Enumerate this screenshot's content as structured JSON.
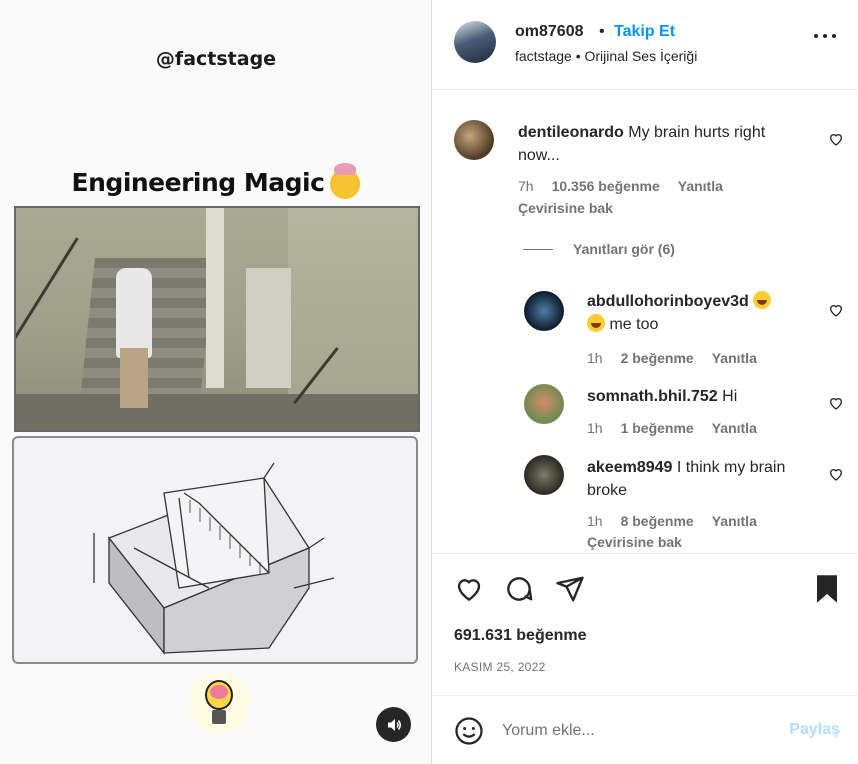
{
  "media": {
    "handle": "@factstage",
    "title": "Engineering Magic"
  },
  "header": {
    "username": "om87608",
    "separator": "•",
    "follow_label": "Takip Et",
    "subtitle": "factstage • Orijinal Ses İçeriği"
  },
  "comments": [
    {
      "username": "dentileonardo",
      "text": "My brain hurts right now...",
      "time": "7h",
      "likes": "10.356 beğenme",
      "reply": "Yanıtla",
      "translate": "Çevirisine bak",
      "view_replies": "Yanıtları gör (6)"
    },
    {
      "username": "abdullohorinboyev3d",
      "text": "me too",
      "time": "1h",
      "likes": "2 beğenme",
      "reply": "Yanıtla"
    },
    {
      "username": "somnath.bhil.752",
      "text": "Hi",
      "time": "1h",
      "likes": "1 beğenme",
      "reply": "Yanıtla"
    },
    {
      "username": "akeem8949",
      "text": "I think my brain broke",
      "time": "1h",
      "likes": "8 beğenme",
      "reply": "Yanıtla",
      "translate": "Çevirisine bak"
    }
  ],
  "actions": {
    "likes": "691.631 beğenme",
    "date": "KASIM 25, 2022"
  },
  "composer": {
    "placeholder": "Yorum ekle...",
    "post_label": "Paylaş"
  },
  "colors": {
    "accent": "#0095f6",
    "post_disabled": "#b2dffc",
    "muted": "#737373",
    "text": "#262626"
  },
  "icons": [
    "heart-icon",
    "comment-icon",
    "share-icon",
    "bookmark-icon",
    "sound-icon",
    "smile-icon",
    "more-icon"
  ]
}
